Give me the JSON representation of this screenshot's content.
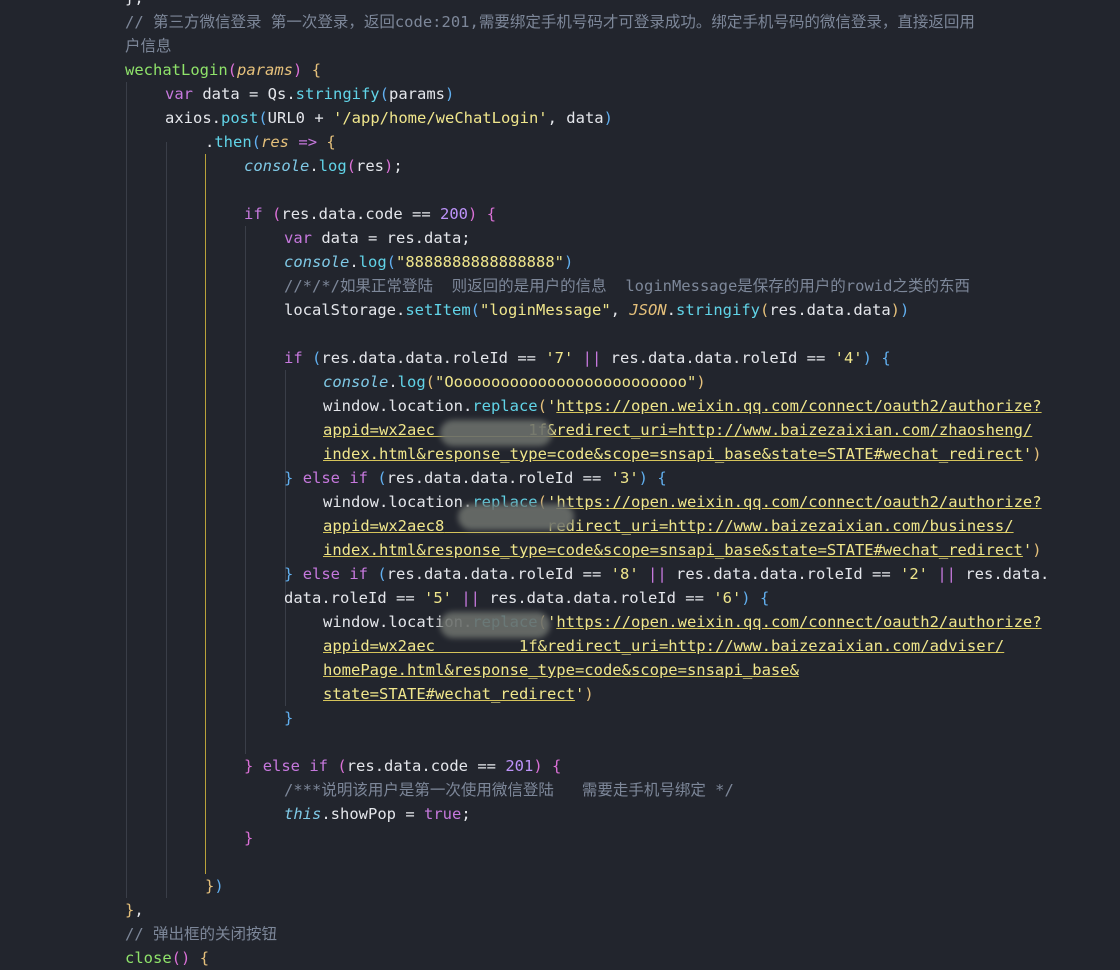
{
  "editor": {
    "lines": [
      [
        {
          "c": "t-punc",
          "t": "},"
        }
      ],
      [
        {
          "c": "t-comment",
          "t": "// 第三方微信登录 第一次登录，返回code:201,需要绑定手机号码才可登录成功。绑定手机号码的微信登录，直接返回用"
        }
      ],
      [
        {
          "c": "t-comment",
          "t": "户信息"
        }
      ],
      [
        {
          "c": "t-fnname",
          "t": "wechatLogin"
        },
        {
          "c": "t-brace2",
          "t": "("
        },
        {
          "c": "t-param",
          "t": "params"
        },
        {
          "c": "t-brace2",
          "t": ")"
        },
        {
          "c": "t-punc",
          "t": " "
        },
        {
          "c": "t-brace",
          "t": "{"
        }
      ],
      [
        {
          "c": "t-keyword",
          "t": "var"
        },
        {
          "c": "t-punc",
          "t": " data = Qs."
        },
        {
          "c": "t-fn",
          "t": "stringify"
        },
        {
          "c": "t-brace3",
          "t": "("
        },
        {
          "c": "t-punc",
          "t": "params"
        },
        {
          "c": "t-brace3",
          "t": ")"
        }
      ],
      [
        {
          "c": "t-punc",
          "t": "axios."
        },
        {
          "c": "t-fn",
          "t": "post"
        },
        {
          "c": "t-brace3",
          "t": "("
        },
        {
          "c": "t-punc",
          "t": "URL0 + "
        },
        {
          "c": "t-string",
          "t": "'/app/home/weChatLogin'"
        },
        {
          "c": "t-punc",
          "t": ", data"
        },
        {
          "c": "t-brace3",
          "t": ")"
        }
      ],
      [
        {
          "c": "t-punc",
          "t": "."
        },
        {
          "c": "t-fn",
          "t": "then"
        },
        {
          "c": "t-brace3",
          "t": "("
        },
        {
          "c": "t-param",
          "t": "res"
        },
        {
          "c": "t-punc",
          "t": " "
        },
        {
          "c": "t-keyword",
          "t": "=>"
        },
        {
          "c": "t-punc",
          "t": " "
        },
        {
          "c": "t-brace",
          "t": "{"
        }
      ],
      [
        {
          "c": "t-italic",
          "t": "console"
        },
        {
          "c": "t-punc",
          "t": "."
        },
        {
          "c": "t-fn",
          "t": "log"
        },
        {
          "c": "t-brace2",
          "t": "("
        },
        {
          "c": "t-punc",
          "t": "res"
        },
        {
          "c": "t-brace2",
          "t": ")"
        },
        {
          "c": "t-punc",
          "t": ";"
        }
      ],
      [],
      [
        {
          "c": "t-keyword",
          "t": "if"
        },
        {
          "c": "t-punc",
          "t": " "
        },
        {
          "c": "t-brace2",
          "t": "("
        },
        {
          "c": "t-punc",
          "t": "res.data.code == "
        },
        {
          "c": "t-num",
          "t": "200"
        },
        {
          "c": "t-brace2",
          "t": ")"
        },
        {
          "c": "t-punc",
          "t": " "
        },
        {
          "c": "t-brace2",
          "t": "{"
        }
      ],
      [
        {
          "c": "t-keyword",
          "t": "var"
        },
        {
          "c": "t-punc",
          "t": " data = res.data;"
        }
      ],
      [
        {
          "c": "t-italic",
          "t": "console"
        },
        {
          "c": "t-punc",
          "t": "."
        },
        {
          "c": "t-fn",
          "t": "log"
        },
        {
          "c": "t-brace3",
          "t": "("
        },
        {
          "c": "t-string",
          "t": "\"8888888888888888\""
        },
        {
          "c": "t-brace3",
          "t": ")"
        }
      ],
      [
        {
          "c": "t-comment",
          "t": "//*/*/如果正常登陆  则返回的是用户的信息  loginMessage是保存的用户的rowid之类的东西"
        }
      ],
      [
        {
          "c": "t-punc",
          "t": "localStorage."
        },
        {
          "c": "t-fn",
          "t": "setItem"
        },
        {
          "c": "t-brace3",
          "t": "("
        },
        {
          "c": "t-string",
          "t": "\"loginMessage\""
        },
        {
          "c": "t-punc",
          "t": ", "
        },
        {
          "c": "t-param",
          "t": "JSON"
        },
        {
          "c": "t-punc",
          "t": "."
        },
        {
          "c": "t-fn",
          "t": "stringify"
        },
        {
          "c": "t-brace",
          "t": "("
        },
        {
          "c": "t-punc",
          "t": "res.data.data"
        },
        {
          "c": "t-brace",
          "t": ")"
        },
        {
          "c": "t-brace3",
          "t": ")"
        }
      ],
      [],
      [
        {
          "c": "t-keyword",
          "t": "if"
        },
        {
          "c": "t-punc",
          "t": " "
        },
        {
          "c": "t-brace3",
          "t": "("
        },
        {
          "c": "t-punc",
          "t": "res.data.data.roleId == "
        },
        {
          "c": "t-string",
          "t": "'7'"
        },
        {
          "c": "t-punc",
          "t": " "
        },
        {
          "c": "t-keyword",
          "t": "||"
        },
        {
          "c": "t-punc",
          "t": " res.data.data.roleId == "
        },
        {
          "c": "t-string",
          "t": "'4'"
        },
        {
          "c": "t-brace3",
          "t": ")"
        },
        {
          "c": "t-punc",
          "t": " "
        },
        {
          "c": "t-brace3",
          "t": "{"
        }
      ],
      [
        {
          "c": "t-italic",
          "t": "console"
        },
        {
          "c": "t-punc",
          "t": "."
        },
        {
          "c": "t-fn",
          "t": "log"
        },
        {
          "c": "t-brace",
          "t": "("
        },
        {
          "c": "t-string",
          "t": "\"Oooooooooooooooooooooooooo\""
        },
        {
          "c": "t-brace",
          "t": ")"
        }
      ],
      [
        {
          "c": "t-punc",
          "t": "window.location."
        },
        {
          "c": "t-fn",
          "t": "replace"
        },
        {
          "c": "t-brace",
          "t": "("
        },
        {
          "c": "t-string",
          "t": "'"
        },
        {
          "c": "t-url",
          "t": "https://open.weixin.qq.com/connect/oauth2/authorize?"
        }
      ],
      [
        {
          "c": "t-url",
          "t": "appid=wx2aec"
        },
        {
          "c": "t-url",
          "t": "          "
        },
        {
          "c": "t-url",
          "t": "1f&redirect_uri=http://www.baizezaixian.com/zhaosheng/"
        }
      ],
      [
        {
          "c": "t-url",
          "t": "index.html&response_type=code&scope=snsapi_base&state=STATE#wechat_redirect"
        },
        {
          "c": "t-string",
          "t": "'"
        },
        {
          "c": "t-brace",
          "t": ")"
        }
      ],
      [
        {
          "c": "t-brace3",
          "t": "}"
        },
        {
          "c": "t-punc",
          "t": " "
        },
        {
          "c": "t-keyword",
          "t": "else if"
        },
        {
          "c": "t-punc",
          "t": " "
        },
        {
          "c": "t-brace3",
          "t": "("
        },
        {
          "c": "t-punc",
          "t": "res.data.data.roleId == "
        },
        {
          "c": "t-string",
          "t": "'3'"
        },
        {
          "c": "t-brace3",
          "t": ")"
        },
        {
          "c": "t-punc",
          "t": " "
        },
        {
          "c": "t-brace3",
          "t": "{"
        }
      ],
      [
        {
          "c": "t-punc",
          "t": "window.location."
        },
        {
          "c": "t-fn",
          "t": "replace"
        },
        {
          "c": "t-brace",
          "t": "("
        },
        {
          "c": "t-string",
          "t": "'"
        },
        {
          "c": "t-url",
          "t": "https://open.weixin.qq.com/connect/oauth2/authorize?"
        }
      ],
      [
        {
          "c": "t-url",
          "t": "appid=wx2aec8"
        },
        {
          "c": "t-url",
          "t": "           "
        },
        {
          "c": "t-url",
          "t": "redirect_uri=http://www.baizezaixian.com/business/"
        }
      ],
      [
        {
          "c": "t-url",
          "t": "index.html&response_type=code&scope=snsapi_base&state=STATE#wechat_redirect"
        },
        {
          "c": "t-string",
          "t": "'"
        },
        {
          "c": "t-brace",
          "t": ")"
        }
      ],
      [
        {
          "c": "t-brace3",
          "t": "}"
        },
        {
          "c": "t-punc",
          "t": " "
        },
        {
          "c": "t-keyword",
          "t": "else if"
        },
        {
          "c": "t-punc",
          "t": " "
        },
        {
          "c": "t-brace3",
          "t": "("
        },
        {
          "c": "t-punc",
          "t": "res.data.data.roleId == "
        },
        {
          "c": "t-string",
          "t": "'8'"
        },
        {
          "c": "t-punc",
          "t": " "
        },
        {
          "c": "t-keyword",
          "t": "||"
        },
        {
          "c": "t-punc",
          "t": " res.data.data.roleId == "
        },
        {
          "c": "t-string",
          "t": "'2'"
        },
        {
          "c": "t-punc",
          "t": " "
        },
        {
          "c": "t-keyword",
          "t": "||"
        },
        {
          "c": "t-punc",
          "t": " res.data."
        }
      ],
      [
        {
          "c": "t-punc",
          "t": "data.roleId == "
        },
        {
          "c": "t-string",
          "t": "'5'"
        },
        {
          "c": "t-punc",
          "t": " "
        },
        {
          "c": "t-keyword",
          "t": "||"
        },
        {
          "c": "t-punc",
          "t": " res.data.data.roleId == "
        },
        {
          "c": "t-string",
          "t": "'6'"
        },
        {
          "c": "t-brace3",
          "t": ")"
        },
        {
          "c": "t-punc",
          "t": " "
        },
        {
          "c": "t-brace3",
          "t": "{"
        }
      ],
      [
        {
          "c": "t-punc",
          "t": "window.location."
        },
        {
          "c": "t-fn",
          "t": "replace"
        },
        {
          "c": "t-brace",
          "t": "("
        },
        {
          "c": "t-string",
          "t": "'"
        },
        {
          "c": "t-url",
          "t": "https://open.weixin.qq.com/connect/oauth2/authorize?"
        }
      ],
      [
        {
          "c": "t-url",
          "t": "appid=wx2aec"
        },
        {
          "c": "t-url",
          "t": "         "
        },
        {
          "c": "t-url",
          "t": "1f&redirect_uri=http://www.baizezaixian.com/adviser/"
        }
      ],
      [
        {
          "c": "t-url",
          "t": "homePage.html&response_type=code&scope=snsapi_base&"
        }
      ],
      [
        {
          "c": "t-url",
          "t": "state=STATE#wechat_redirect"
        },
        {
          "c": "t-string",
          "t": "'"
        },
        {
          "c": "t-brace",
          "t": ")"
        }
      ],
      [
        {
          "c": "t-brace3",
          "t": "}"
        }
      ],
      [],
      [
        {
          "c": "t-brace2",
          "t": "}"
        },
        {
          "c": "t-punc",
          "t": " "
        },
        {
          "c": "t-keyword",
          "t": "else if"
        },
        {
          "c": "t-punc",
          "t": " "
        },
        {
          "c": "t-brace2",
          "t": "("
        },
        {
          "c": "t-punc",
          "t": "res.data.code == "
        },
        {
          "c": "t-num",
          "t": "201"
        },
        {
          "c": "t-brace2",
          "t": ")"
        },
        {
          "c": "t-punc",
          "t": " "
        },
        {
          "c": "t-brace2",
          "t": "{"
        }
      ],
      [
        {
          "c": "t-comment",
          "t": "/***说明该用户是第一次使用微信登陆   需要走手机号绑定 */"
        }
      ],
      [
        {
          "c": "t-this",
          "t": "this"
        },
        {
          "c": "t-punc",
          "t": ".showPop = "
        },
        {
          "c": "t-keyword",
          "t": "true"
        },
        {
          "c": "t-punc",
          "t": ";"
        }
      ],
      [
        {
          "c": "t-brace2",
          "t": "}"
        }
      ],
      [],
      [
        {
          "c": "t-brace",
          "t": "}"
        },
        {
          "c": "t-brace3",
          "t": ")"
        }
      ],
      [
        {
          "c": "t-brace",
          "t": "}"
        },
        {
          "c": "t-punc",
          "t": ","
        }
      ],
      [
        {
          "c": "t-comment",
          "t": "// 弹出框的关闭按钮"
        }
      ],
      [
        {
          "c": "t-fnname",
          "t": "close"
        },
        {
          "c": "t-brace2",
          "t": "()"
        },
        {
          "c": "t-punc",
          "t": " "
        },
        {
          "c": "t-brace",
          "t": "{"
        }
      ]
    ]
  }
}
